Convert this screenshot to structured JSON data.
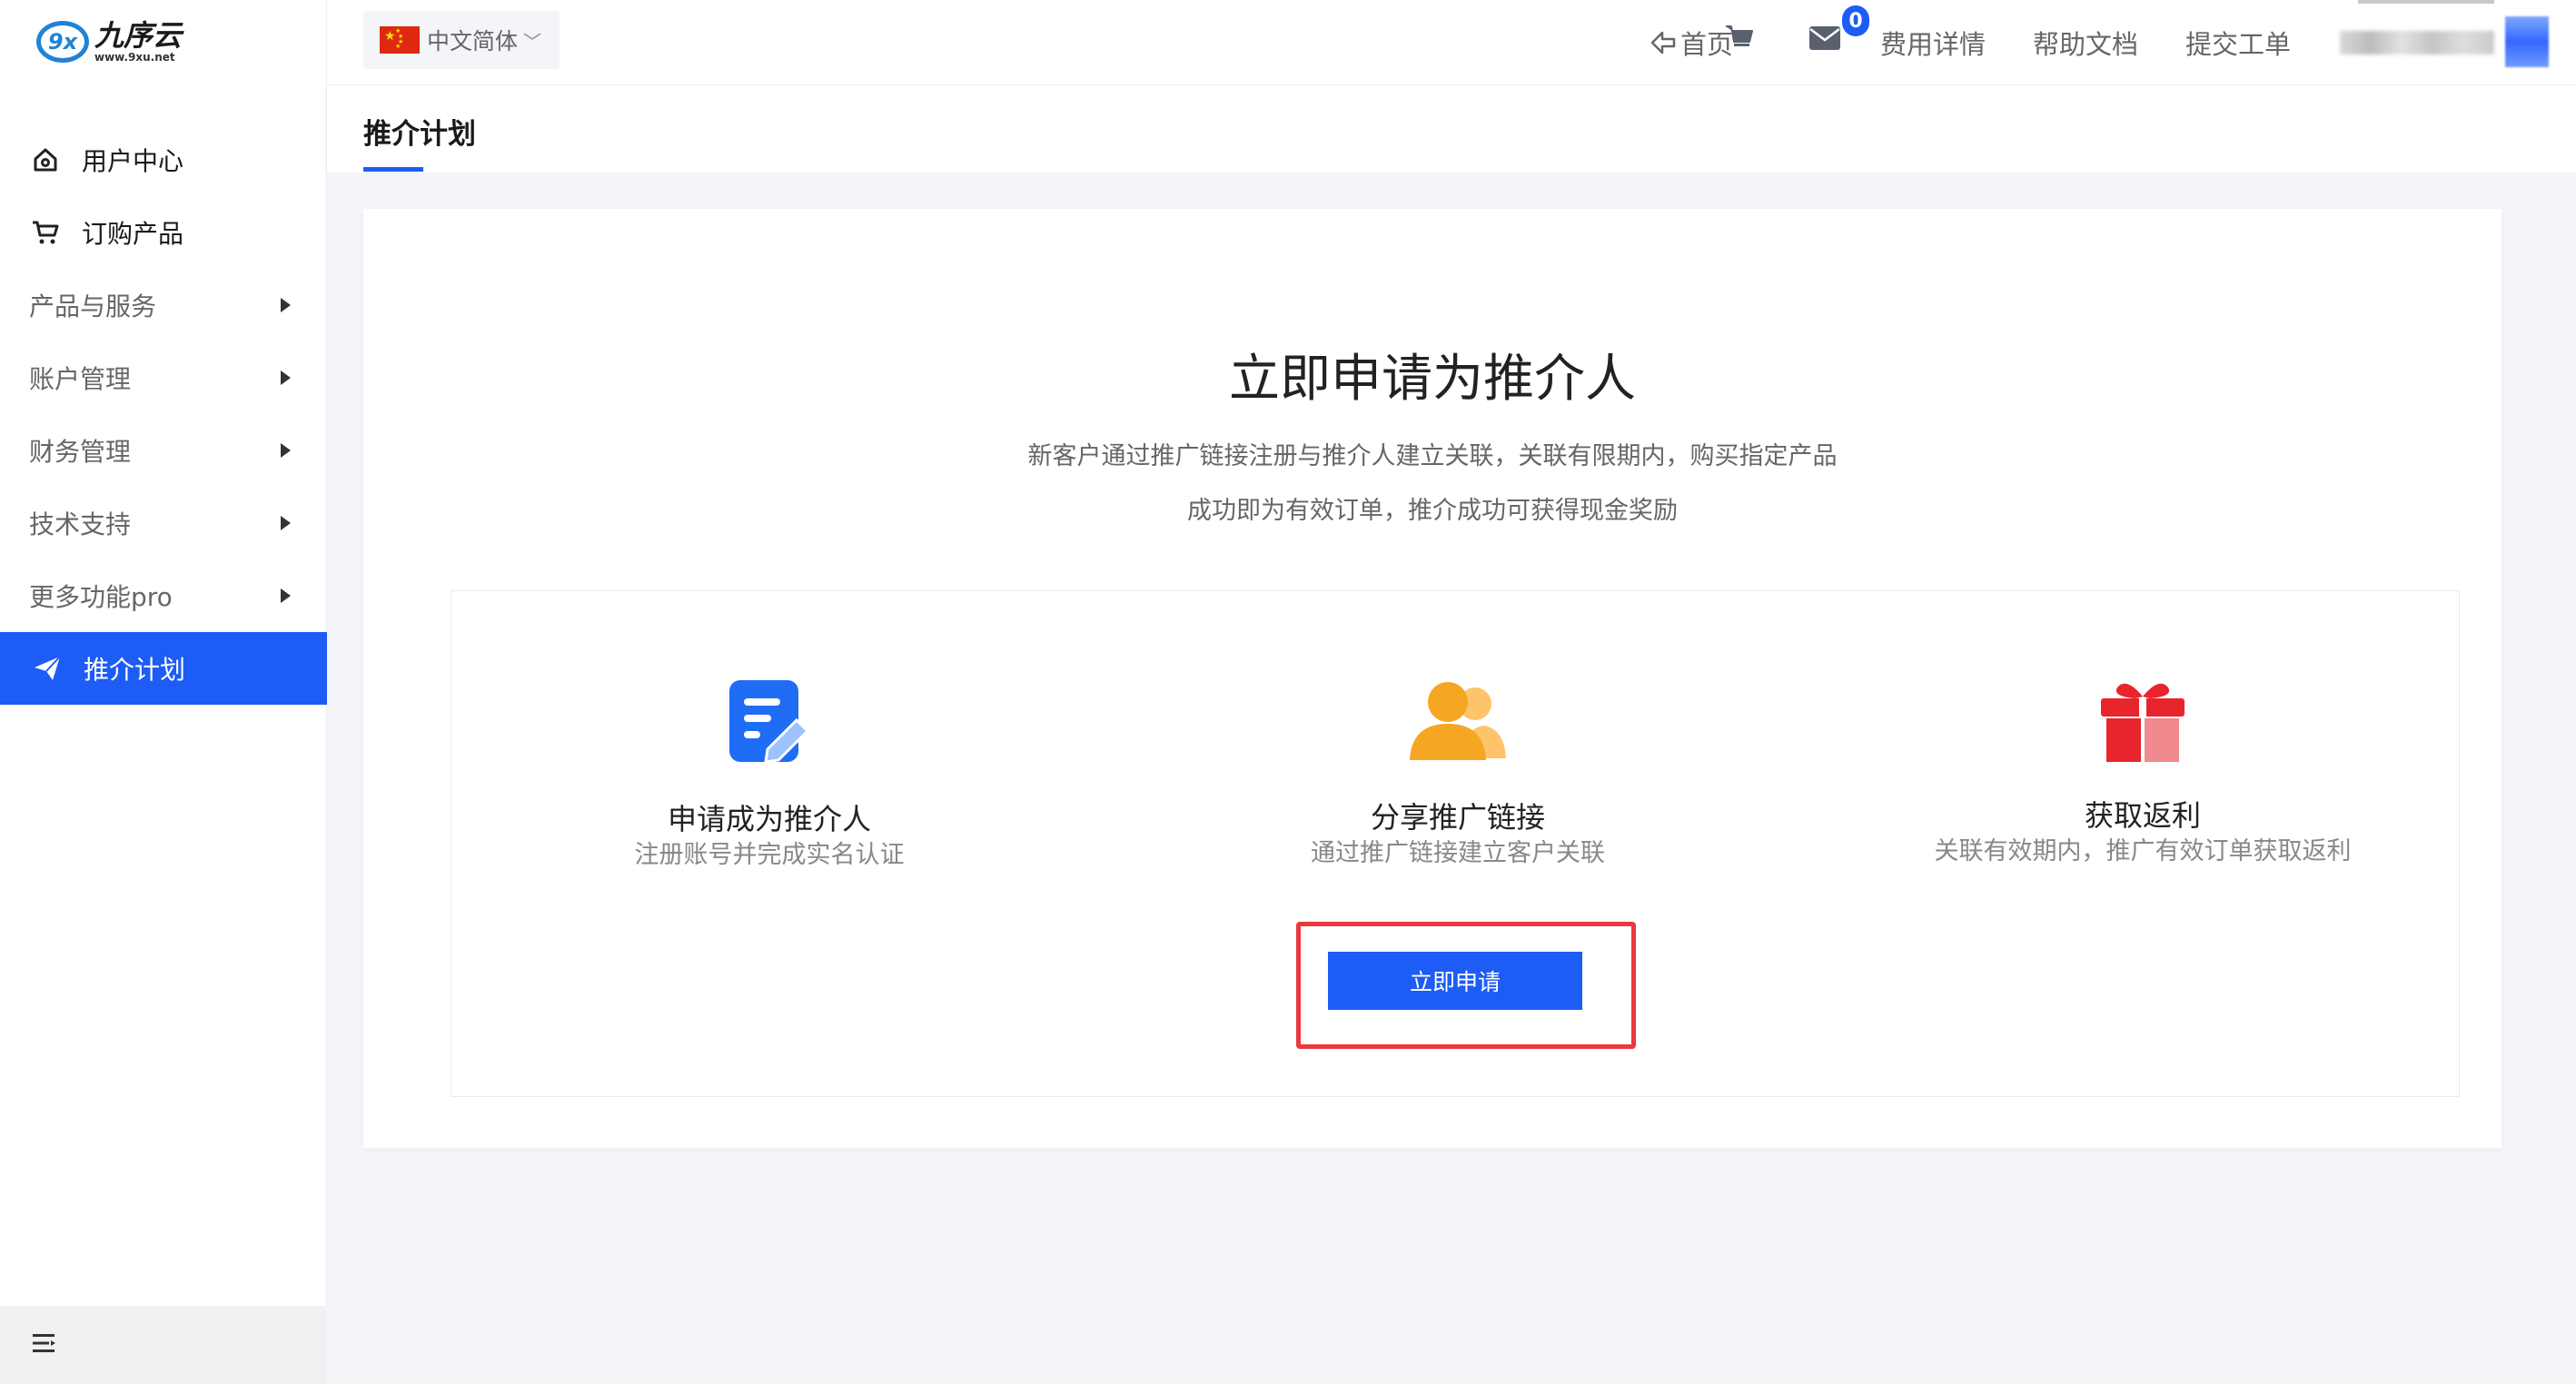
{
  "brand": {
    "logo_badge": "9x",
    "name": "九序云",
    "url": "www.9xu.net"
  },
  "language": {
    "label": "中文简体",
    "flag_icon": "china-flag-icon"
  },
  "topnav": {
    "home": "首页",
    "cart_icon": "cart-icon",
    "mail_icon": "mail-icon",
    "mail_badge": "0",
    "fee_details": "费用详情",
    "help_docs": "帮助文档",
    "submit_ticket": "提交工单"
  },
  "sidebar": {
    "items": [
      {
        "label": "用户中心",
        "icon": "home-icon"
      },
      {
        "label": "订购产品",
        "icon": "cart-icon"
      },
      {
        "label": "产品与服务"
      },
      {
        "label": "账户管理"
      },
      {
        "label": "财务管理"
      },
      {
        "label": "技术支持"
      },
      {
        "label": "更多功能pro"
      },
      {
        "label": "推介计划",
        "icon": "paper-plane-icon"
      }
    ],
    "footer_icon": "menu-collapse-icon"
  },
  "page": {
    "tab_title": "推介计划"
  },
  "hero": {
    "title": "立即申请为推介人",
    "desc_line1": "新客户通过推广链接注册与推介人建立关联，关联有限期内，购买指定产品",
    "desc_line2": "成功即为有效订单，推介成功可获得现金奖励"
  },
  "steps": [
    {
      "title": "申请成为推介人",
      "subtitle": "注册账号并完成实名认证",
      "icon": "edit-document-icon"
    },
    {
      "title": "分享推广链接",
      "subtitle": "通过推广链接建立客户关联",
      "icon": "users-icon"
    },
    {
      "title": "获取返利",
      "subtitle": "关联有效期内，推广有效订单获取返利",
      "icon": "gift-icon"
    }
  ],
  "apply_button": "立即申请",
  "colors": {
    "accent": "#1d5cf5",
    "highlight": "#e8393f",
    "step1_icon": "#1f6cf5",
    "step2_icon": "#f5a623",
    "step3_icon": "#e8242c"
  }
}
